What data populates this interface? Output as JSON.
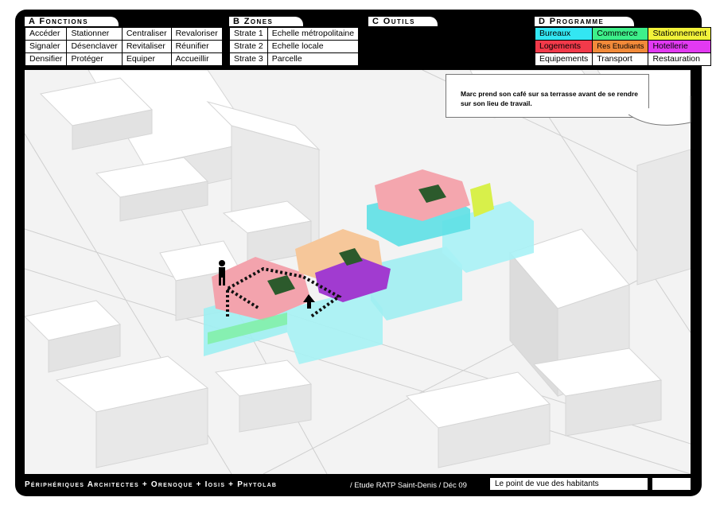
{
  "sections": {
    "a_title": "A Fonctions",
    "b_title": "B Zones",
    "c_title": "C Outils",
    "d_title": "D Programme"
  },
  "fonctions": [
    [
      "Accéder",
      "Stationner",
      "Centraliser",
      "Revaloriser"
    ],
    [
      "Signaler",
      "Désenclaver",
      "Revitaliser",
      "Réunifier"
    ],
    [
      "Densifier",
      "Protéger",
      "Equiper",
      "Accueillir"
    ]
  ],
  "zones": [
    [
      "Strate 1",
      "Echelle métropolitaine"
    ],
    [
      "Strate 2",
      "Echelle locale"
    ],
    [
      "Strate 3",
      "Parcelle"
    ]
  ],
  "programme": [
    [
      {
        "label": "Bureaux",
        "color": "#33e6f2"
      },
      {
        "label": "Commerce",
        "color": "#3ef08a"
      },
      {
        "label": "Stationnement",
        "color": "#f2f23a"
      }
    ],
    [
      {
        "label": "Logements",
        "color": "#f23a4a"
      },
      {
        "label": "Res Etudiants",
        "color": "#f28a3a"
      },
      {
        "label": "Hotellerie",
        "color": "#e23af2"
      }
    ],
    [
      {
        "label": "Equipements",
        "color": "#ffffff"
      },
      {
        "label": "Transport",
        "color": "#ffffff"
      },
      {
        "label": "Restauration",
        "color": "#ffffff"
      }
    ]
  ],
  "bubble_text": "Marc prend son café sur sa terrasse avant de se rendre sur son lieu de travail.",
  "footer": {
    "credits": "Périphériques Architectes + Orenoque + Iosis + Phytolab",
    "study": "/ Etude RATP Saint-Denis / Déc 09",
    "caption": "Le point de vue des habitants",
    "blank": ""
  }
}
